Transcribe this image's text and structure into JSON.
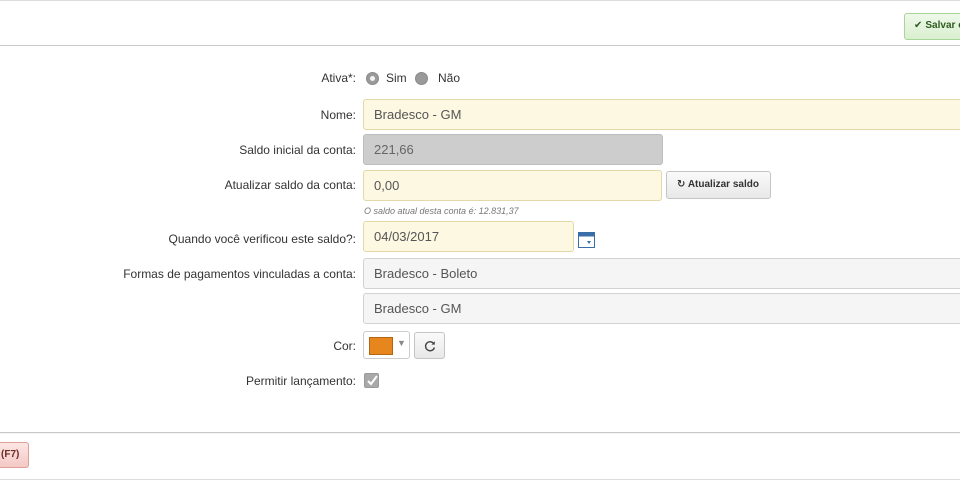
{
  "toolbar": {
    "save_label": "Salvar e",
    "save_icon": "check-icon"
  },
  "form": {
    "ativa": {
      "label": "Ativa*:",
      "options": [
        "Sim",
        "Não"
      ],
      "selected": "Sim"
    },
    "nome": {
      "label": "Nome:",
      "value": "Bradesco - GM"
    },
    "saldo_inicial": {
      "label": "Saldo inicial da conta:",
      "value": "221,66"
    },
    "atualizar_saldo": {
      "label": "Atualizar saldo da conta:",
      "value": "0,00",
      "button_label": "Atualizar saldo",
      "hint": "O saldo atual desta conta é: 12.831,37"
    },
    "verificacao": {
      "label": "Quando você verificou este saldo?:",
      "value": "04/03/2017"
    },
    "formas_pagamento": {
      "label": "Formas de pagamentos vinculadas a conta:",
      "items": [
        "Bradesco - Boleto",
        "Bradesco - GM"
      ]
    },
    "cor": {
      "label": "Cor:",
      "value": "#e8861e"
    },
    "permitir_lancamento": {
      "label": "Permitir lançamento:",
      "checked": true
    }
  },
  "footer": {
    "cancel_label": "(F7)"
  }
}
